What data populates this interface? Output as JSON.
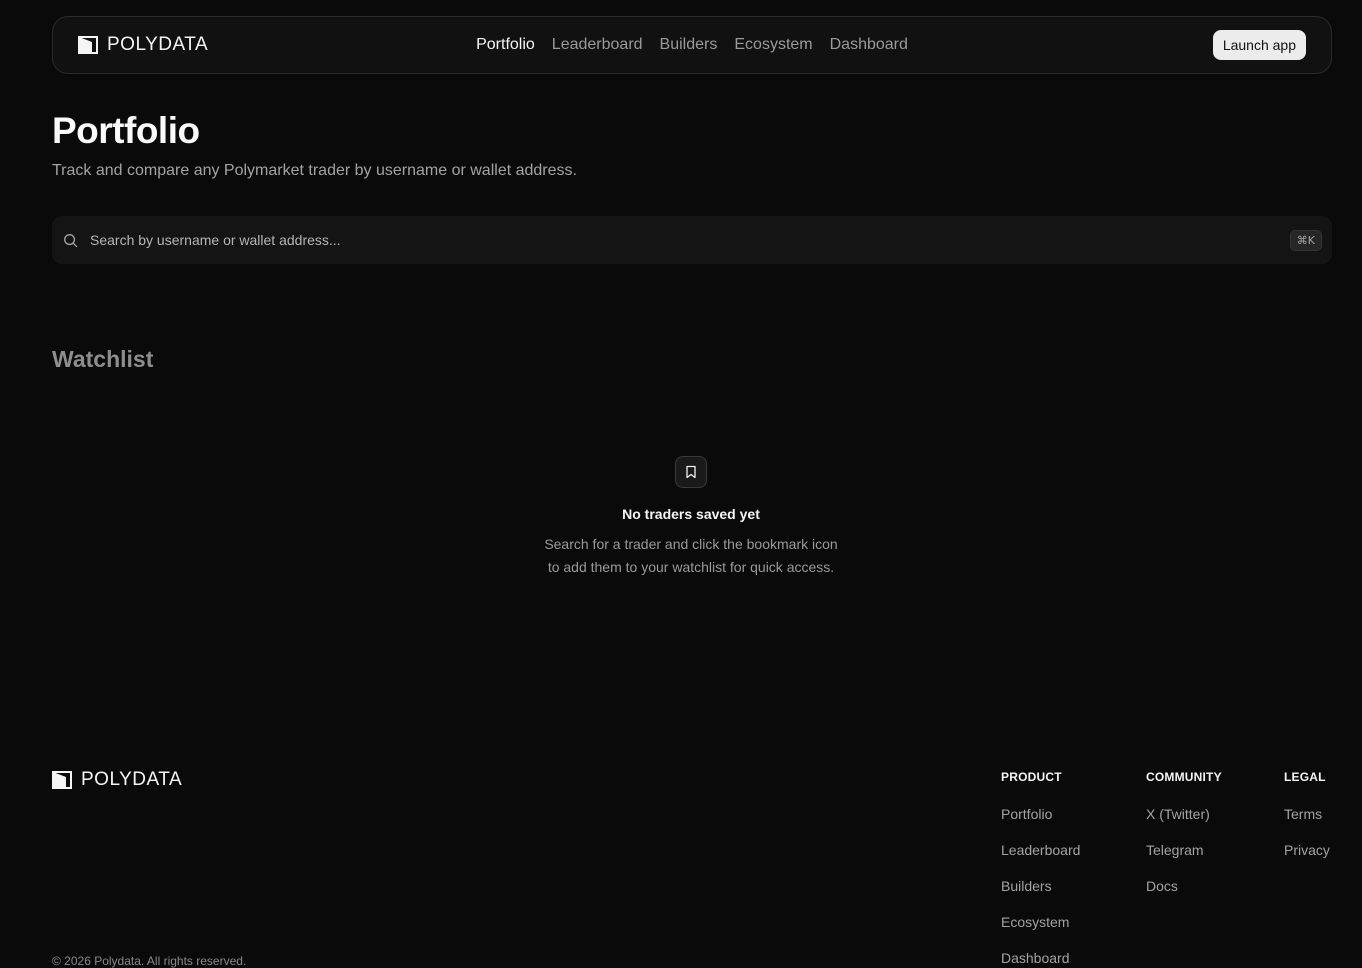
{
  "brand": {
    "name": "POLYDATA"
  },
  "nav": {
    "links": [
      {
        "label": "Portfolio",
        "active": true
      },
      {
        "label": "Leaderboard",
        "active": false
      },
      {
        "label": "Builders",
        "active": false
      },
      {
        "label": "Ecosystem",
        "active": false
      },
      {
        "label": "Dashboard",
        "active": false
      }
    ],
    "launch_label": "Launch app"
  },
  "header": {
    "title": "Portfolio",
    "subtitle": "Track and compare any Polymarket trader by username or wallet address."
  },
  "search": {
    "placeholder": "Search by username or wallet address...",
    "value": "",
    "shortcut": "⌘K"
  },
  "watchlist": {
    "title": "Watchlist",
    "empty_title": "No traders saved yet",
    "empty_line1": "Search for a trader and click the bookmark icon",
    "empty_line2": "to add them to your watchlist for quick access."
  },
  "footer": {
    "product": {
      "title": "PRODUCT",
      "links": [
        "Portfolio",
        "Leaderboard",
        "Builders",
        "Ecosystem",
        "Dashboard"
      ]
    },
    "community": {
      "title": "COMMUNITY",
      "links": [
        "X (Twitter)",
        "Telegram",
        "Docs"
      ]
    },
    "legal": {
      "title": "LEGAL",
      "links": [
        "Terms",
        "Privacy"
      ]
    },
    "copyright": "© 2026 Polydata. All rights reserved."
  },
  "icons": {
    "logo": "polydata-logo-icon",
    "search": "search-icon",
    "empty": "bookmark-icon"
  },
  "colors": {
    "background": "#0a0a0a",
    "accent": "#ececec"
  }
}
